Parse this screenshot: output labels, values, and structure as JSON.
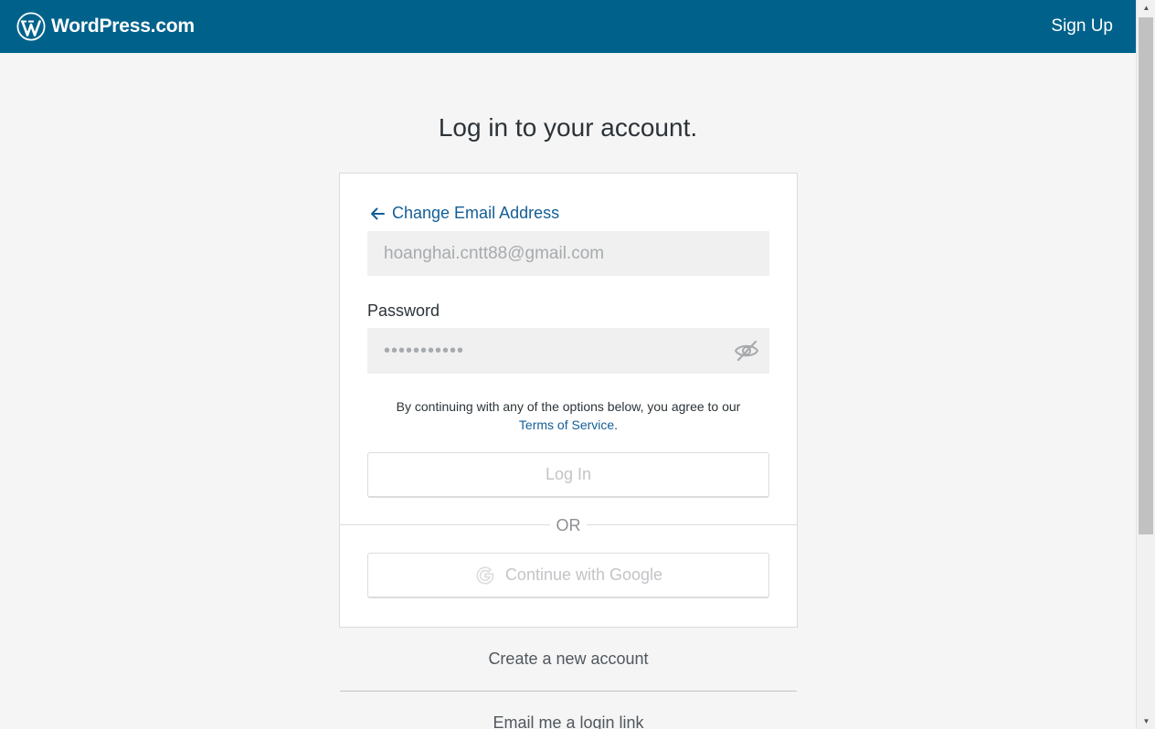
{
  "masterbar": {
    "brand": "WordPress.com",
    "signup_label": "Sign Up"
  },
  "page": {
    "heading": "Log in to your account."
  },
  "login_form": {
    "change_email_label": "Change Email Address",
    "email_value": "hoanghai.cntt88@gmail.com",
    "password_label": "Password",
    "password_masked": "•••••••••••",
    "tos_text": "By continuing with any of the options below, you agree to our",
    "tos_link": "Terms of Service",
    "tos_period": ".",
    "login_button": "Log In",
    "or_text": "OR",
    "google_button": "Continue with Google"
  },
  "footer_links": {
    "create_account": "Create a new account",
    "email_login_link": "Email me a login link"
  },
  "icons": {
    "brand": "wordpress-logo-icon",
    "back": "arrow-left-icon",
    "password_toggle": "eye-slash-icon",
    "google": "google-icon"
  },
  "colors": {
    "masterbar": "#00628b",
    "link": "#135e96",
    "page_background": "#f5f5f5"
  }
}
